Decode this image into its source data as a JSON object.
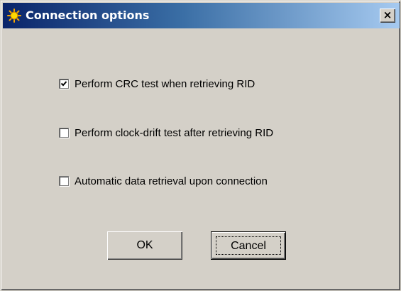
{
  "window": {
    "title": "Connection options",
    "close_label": "×"
  },
  "options": [
    {
      "label": "Perform CRC test when retrieving RID",
      "checked": true
    },
    {
      "label": "Perform clock-drift test after retrieving RID",
      "checked": false
    },
    {
      "label": "Automatic data retrieval upon connection",
      "checked": false
    }
  ],
  "buttons": {
    "ok_label": "OK",
    "cancel_label": "Cancel"
  },
  "colors": {
    "titlebar_start": "#0a246a",
    "titlebar_end": "#a6caf0",
    "dialog_face": "#d4d0c8"
  },
  "icons": {
    "app": "sun-icon",
    "close": "close-icon",
    "check": "checkmark-icon"
  }
}
